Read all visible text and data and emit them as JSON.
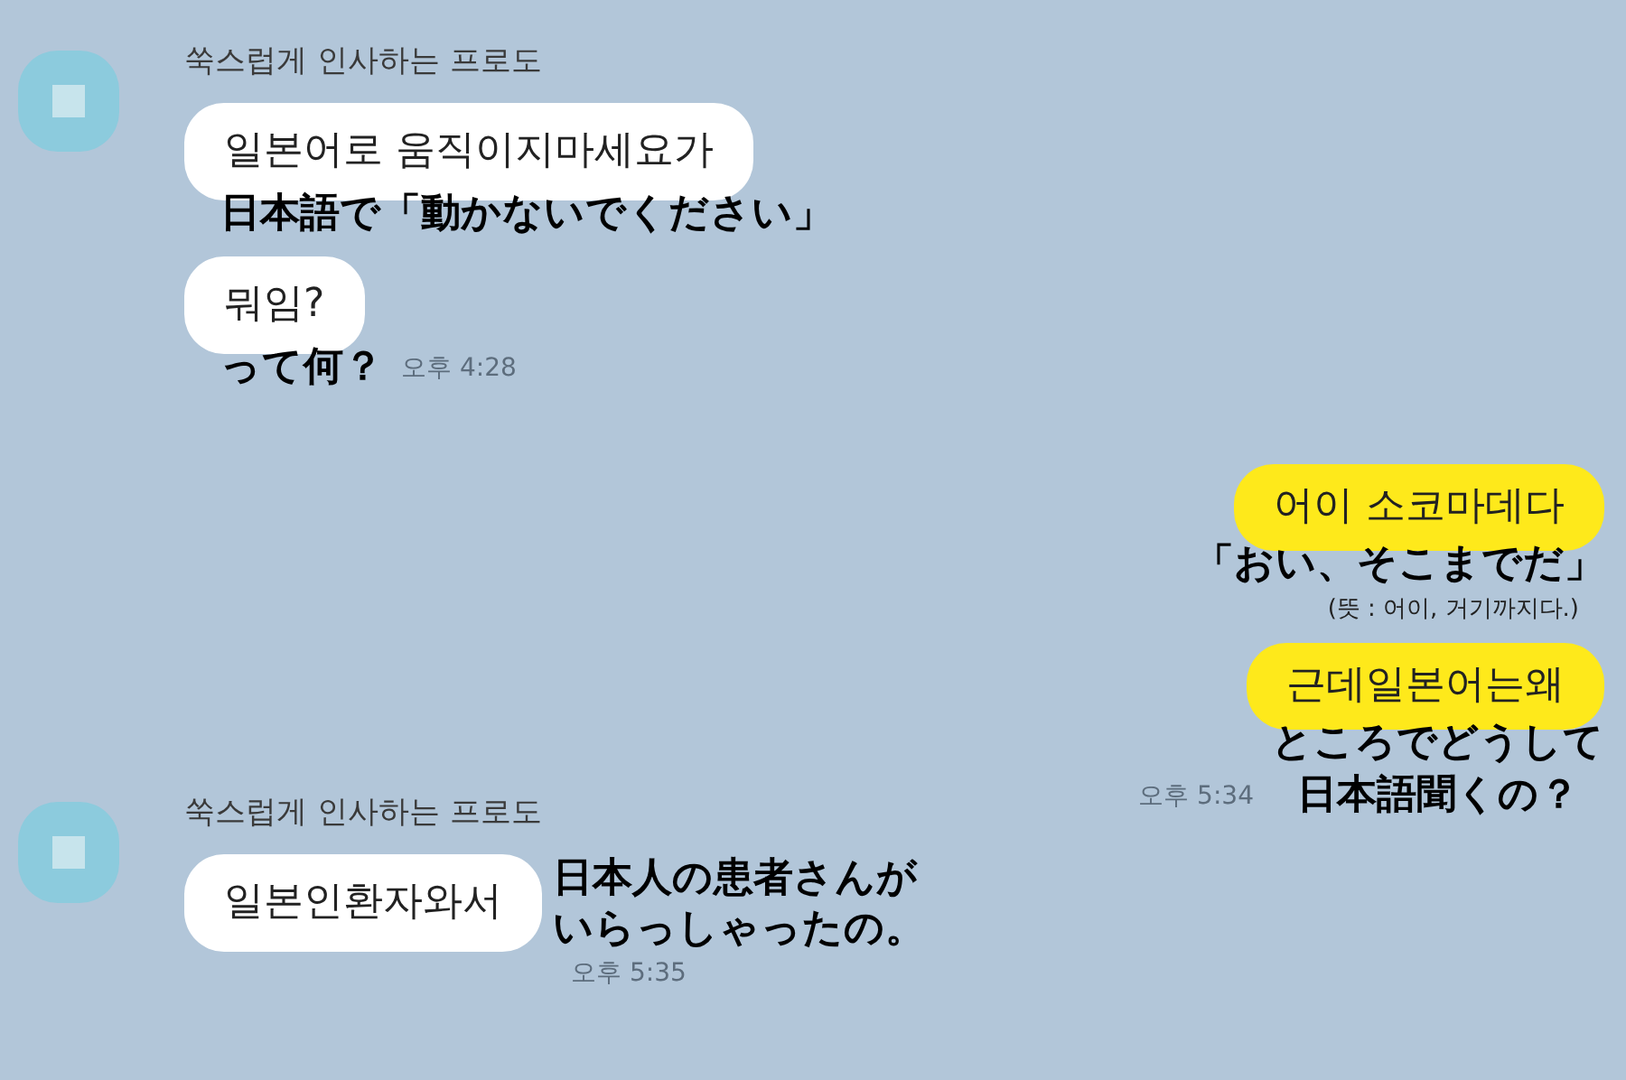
{
  "chat": [
    {
      "kind": "received",
      "sender": "쑥스럽게 인사하는 프로도",
      "messages": [
        {
          "kind": "below",
          "text": "일본어로 움직이지마세요가",
          "translation": [
            "日本語で「動かないでください」"
          ]
        },
        {
          "kind": "below",
          "text": "뭐임?",
          "translation": [
            "って何？"
          ],
          "time": "오후 4:28"
        }
      ]
    },
    {
      "kind": "sent",
      "messages": [
        {
          "kind": "below",
          "text": "어이 소코마데다",
          "translation": [
            "「おい、そこまでだ」"
          ],
          "note": "(뜻 : 어이, 거기까지다.)"
        },
        {
          "kind": "below",
          "text": "근데일본어는왜",
          "translation": [
            "ところでどうして",
            "日本語聞くの？"
          ],
          "time": "오후 5:34"
        }
      ]
    },
    {
      "kind": "received",
      "sender": "쑥스럽게 인사하는 프로도",
      "messages": [
        {
          "kind": "beside",
          "text": "일본인환자와서",
          "translation": [
            "日本人の患者さんが",
            "いらっしゃったの。"
          ],
          "time": "오후 5:35"
        }
      ]
    }
  ]
}
